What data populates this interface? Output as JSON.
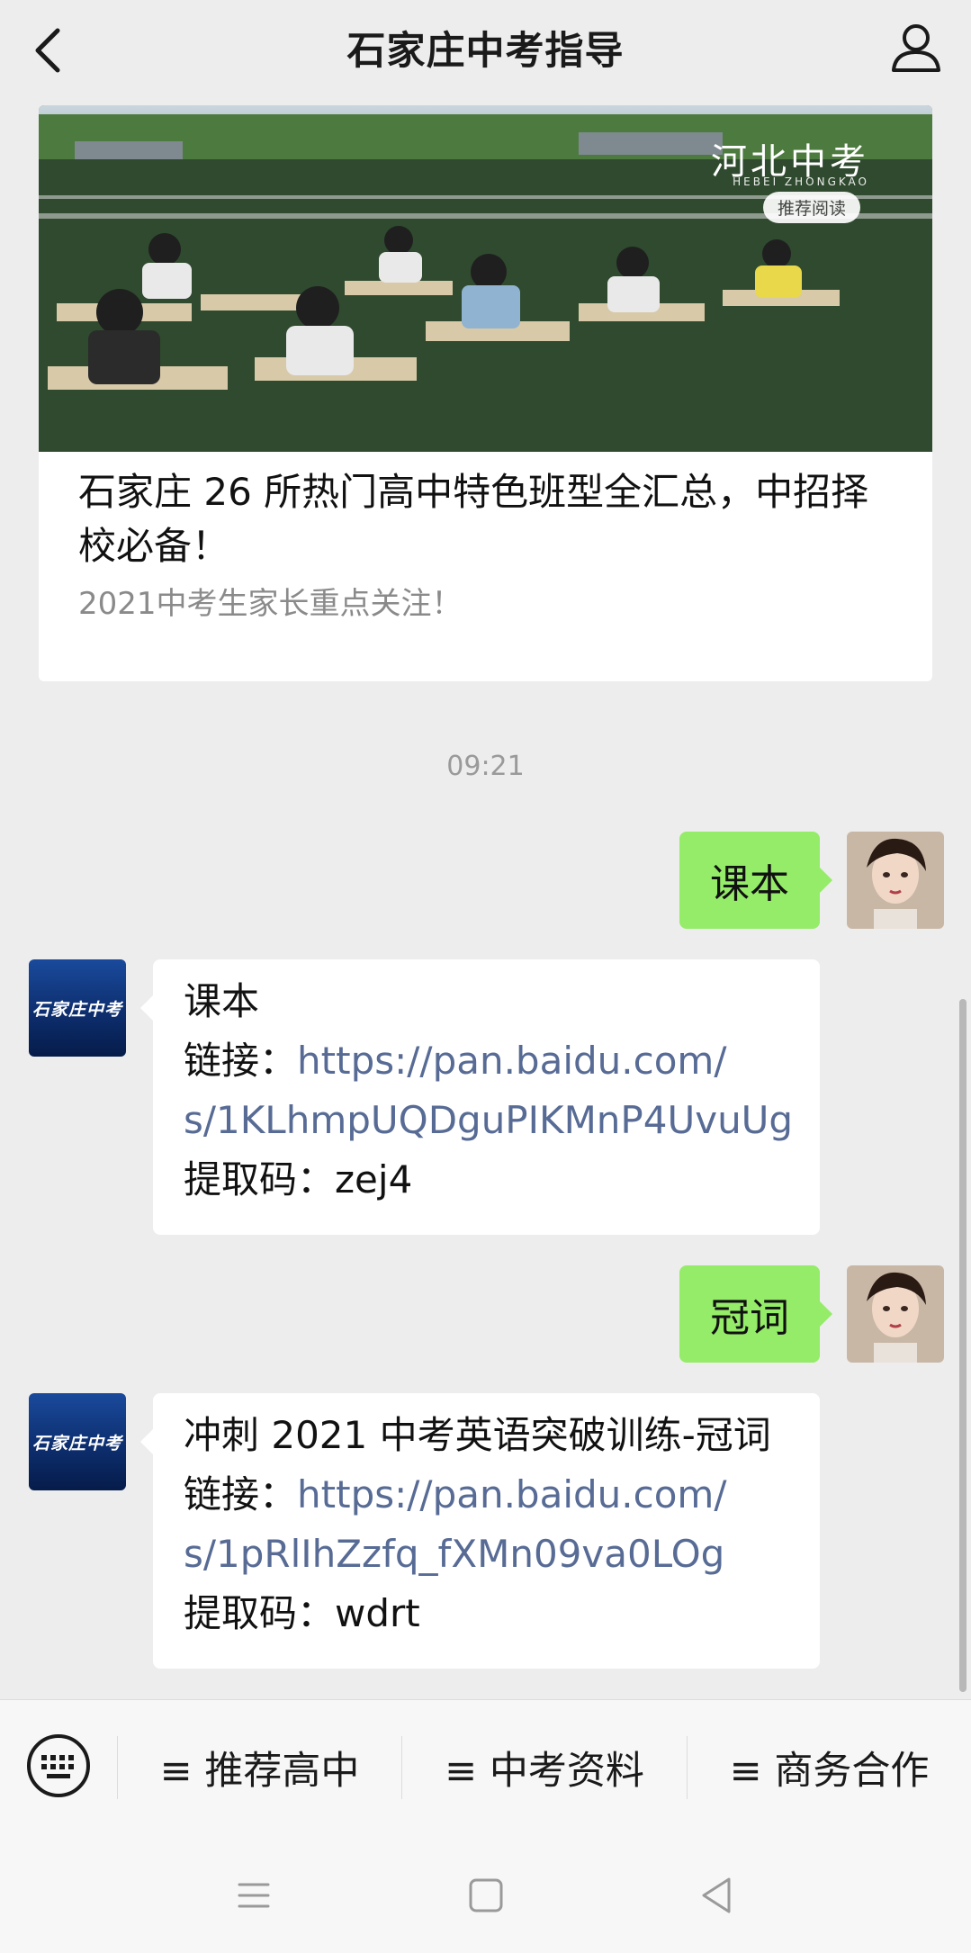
{
  "header": {
    "title": "石家庄中考指导",
    "back_icon": "chevron-left-icon",
    "profile_icon": "person-icon"
  },
  "article": {
    "image_brand": "河北中考",
    "image_brand_sub": "HEBEI ZHONGKAO",
    "image_tag": "推荐阅读",
    "title": "石家庄 26 所热门高中特色班型全汇总，中招择校必备！",
    "subtitle": "2021中考生家长重点关注！"
  },
  "timestamp": "09:21",
  "messages": [
    {
      "from": "user",
      "text": "课本"
    },
    {
      "from": "bot",
      "avatar_text": "石家庄中考",
      "title": "课本",
      "link_label": "链接：",
      "link_line1": "https://pan.baidu.com/",
      "link_line2": "s/1KLhmpUQDguPIKMnP4UvuUg",
      "code_label": "提取码：",
      "code": "zej4"
    },
    {
      "from": "user",
      "text": "冠词"
    },
    {
      "from": "bot",
      "avatar_text": "石家庄中考",
      "title": "冲刺 2021 中考英语突破训练-冠词",
      "link_label": "链接：",
      "link_line1": "https://pan.baidu.com/",
      "link_line2": "s/1pRlIhZzfq_fXMn09va0LOg",
      "code_label": "提取码：",
      "code": "wdrt"
    }
  ],
  "menu": {
    "keyboard_icon": "keyboard-icon",
    "items": [
      {
        "label": "≡ 推荐高中"
      },
      {
        "label": "≡ 中考资料"
      },
      {
        "label": "≡ 商务合作"
      }
    ]
  },
  "colors": {
    "user_bubble": "#95ec69",
    "link": "#576b95",
    "background": "#ededed"
  }
}
